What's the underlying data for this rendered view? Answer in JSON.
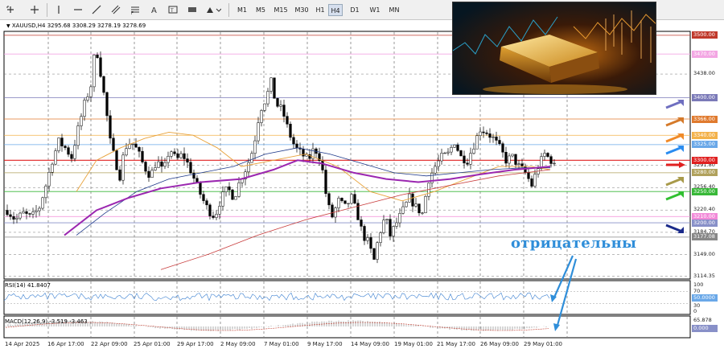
{
  "toolbar": {
    "timeframes": [
      {
        "label": "M1",
        "active": false
      },
      {
        "label": "M5",
        "active": false
      },
      {
        "label": "M15",
        "active": false
      },
      {
        "label": "M30",
        "active": false
      },
      {
        "label": "H1",
        "active": false
      },
      {
        "label": "H4",
        "active": true
      },
      {
        "label": "D1",
        "active": false
      },
      {
        "label": "W1",
        "active": false
      },
      {
        "label": "MN",
        "active": false
      }
    ]
  },
  "chart": {
    "header": "XAUUSD,H4  3295.68 3308.29 3278.19 3278.69",
    "annotation": "отрицательны"
  },
  "price_axis": {
    "ticks": [
      "3438.00",
      "3291.80",
      "3256.40",
      "3220.40",
      "3184.70",
      "3149.00",
      "3114.35"
    ],
    "level_labels": [
      {
        "text": "3500.00",
        "bg": "#c0392b",
        "fg": "#ffffff",
        "price": 3500
      },
      {
        "text": "3470.00",
        "bg": "#f3a6e3",
        "fg": "#ffffff",
        "price": 3470
      },
      {
        "text": "3400.00",
        "bg": "#7b7ab8",
        "fg": "#ffffff",
        "price": 3400
      },
      {
        "text": "3366.00",
        "bg": "#e07a2e",
        "fg": "#ffffff",
        "price": 3366
      },
      {
        "text": "3340.00",
        "bg": "#f3b24a",
        "fg": "#ffffff",
        "price": 3340
      },
      {
        "text": "3325.00",
        "bg": "#6aa8e8",
        "fg": "#ffffff",
        "price": 3325
      },
      {
        "text": "3300.00",
        "bg": "#e02020",
        "fg": "#ffffff",
        "price": 3300
      },
      {
        "text": "3280.00",
        "bg": "#b0a15c",
        "fg": "#ffffff",
        "price": 3280
      },
      {
        "text": "3250.00",
        "bg": "#38b838",
        "fg": "#ffffff",
        "price": 3250
      },
      {
        "text": "3210.00",
        "bg": "#f28ad8",
        "fg": "#ffffff",
        "price": 3210
      },
      {
        "text": "3200.00",
        "bg": "#8890c8",
        "fg": "#ffffff",
        "price": 3200
      },
      {
        "text": "3177.08",
        "bg": "#888888",
        "fg": "#ffffff",
        "price": 3177.08
      }
    ]
  },
  "rsi": {
    "label": "RSI(14) 41.8407",
    "ticks": [
      "100",
      "70",
      "30",
      "0"
    ],
    "value_label": "50.0000",
    "value": 41.8407
  },
  "macd": {
    "label": "MACD(12,26,9) -3.519 -3.463",
    "ticks": [
      "65.878"
    ],
    "value_label": "0.000"
  },
  "time_axis": {
    "labels": [
      "14 Apr 2025",
      "16 Apr 17:00",
      "22 Apr 09:00",
      "25 Apr 01:00",
      "29 Apr 17:00",
      "2 May 09:00",
      "7 May 01:00",
      "9 May 17:00",
      "14 May 09:00",
      "19 May 01:00",
      "21 May 17:00",
      "26 May 09:00",
      "29 May 01:00"
    ]
  },
  "colors": {
    "grid": "#000000",
    "ma_fast": "#e8a23a",
    "ma_mid": "#1f3a8a",
    "ma_slow": "#c83c3c",
    "ma_purple": "#9b27b0",
    "rsi_line": "#3a7fd0",
    "annotation": "#2f8ed9"
  },
  "arrows": {
    "colors": [
      "#6f6fc0",
      "#d57a2a",
      "#f08a28",
      "#2a8cf0",
      "#e02020",
      "#a89a4a",
      "#30c030",
      "#1a2a8a"
    ]
  }
}
